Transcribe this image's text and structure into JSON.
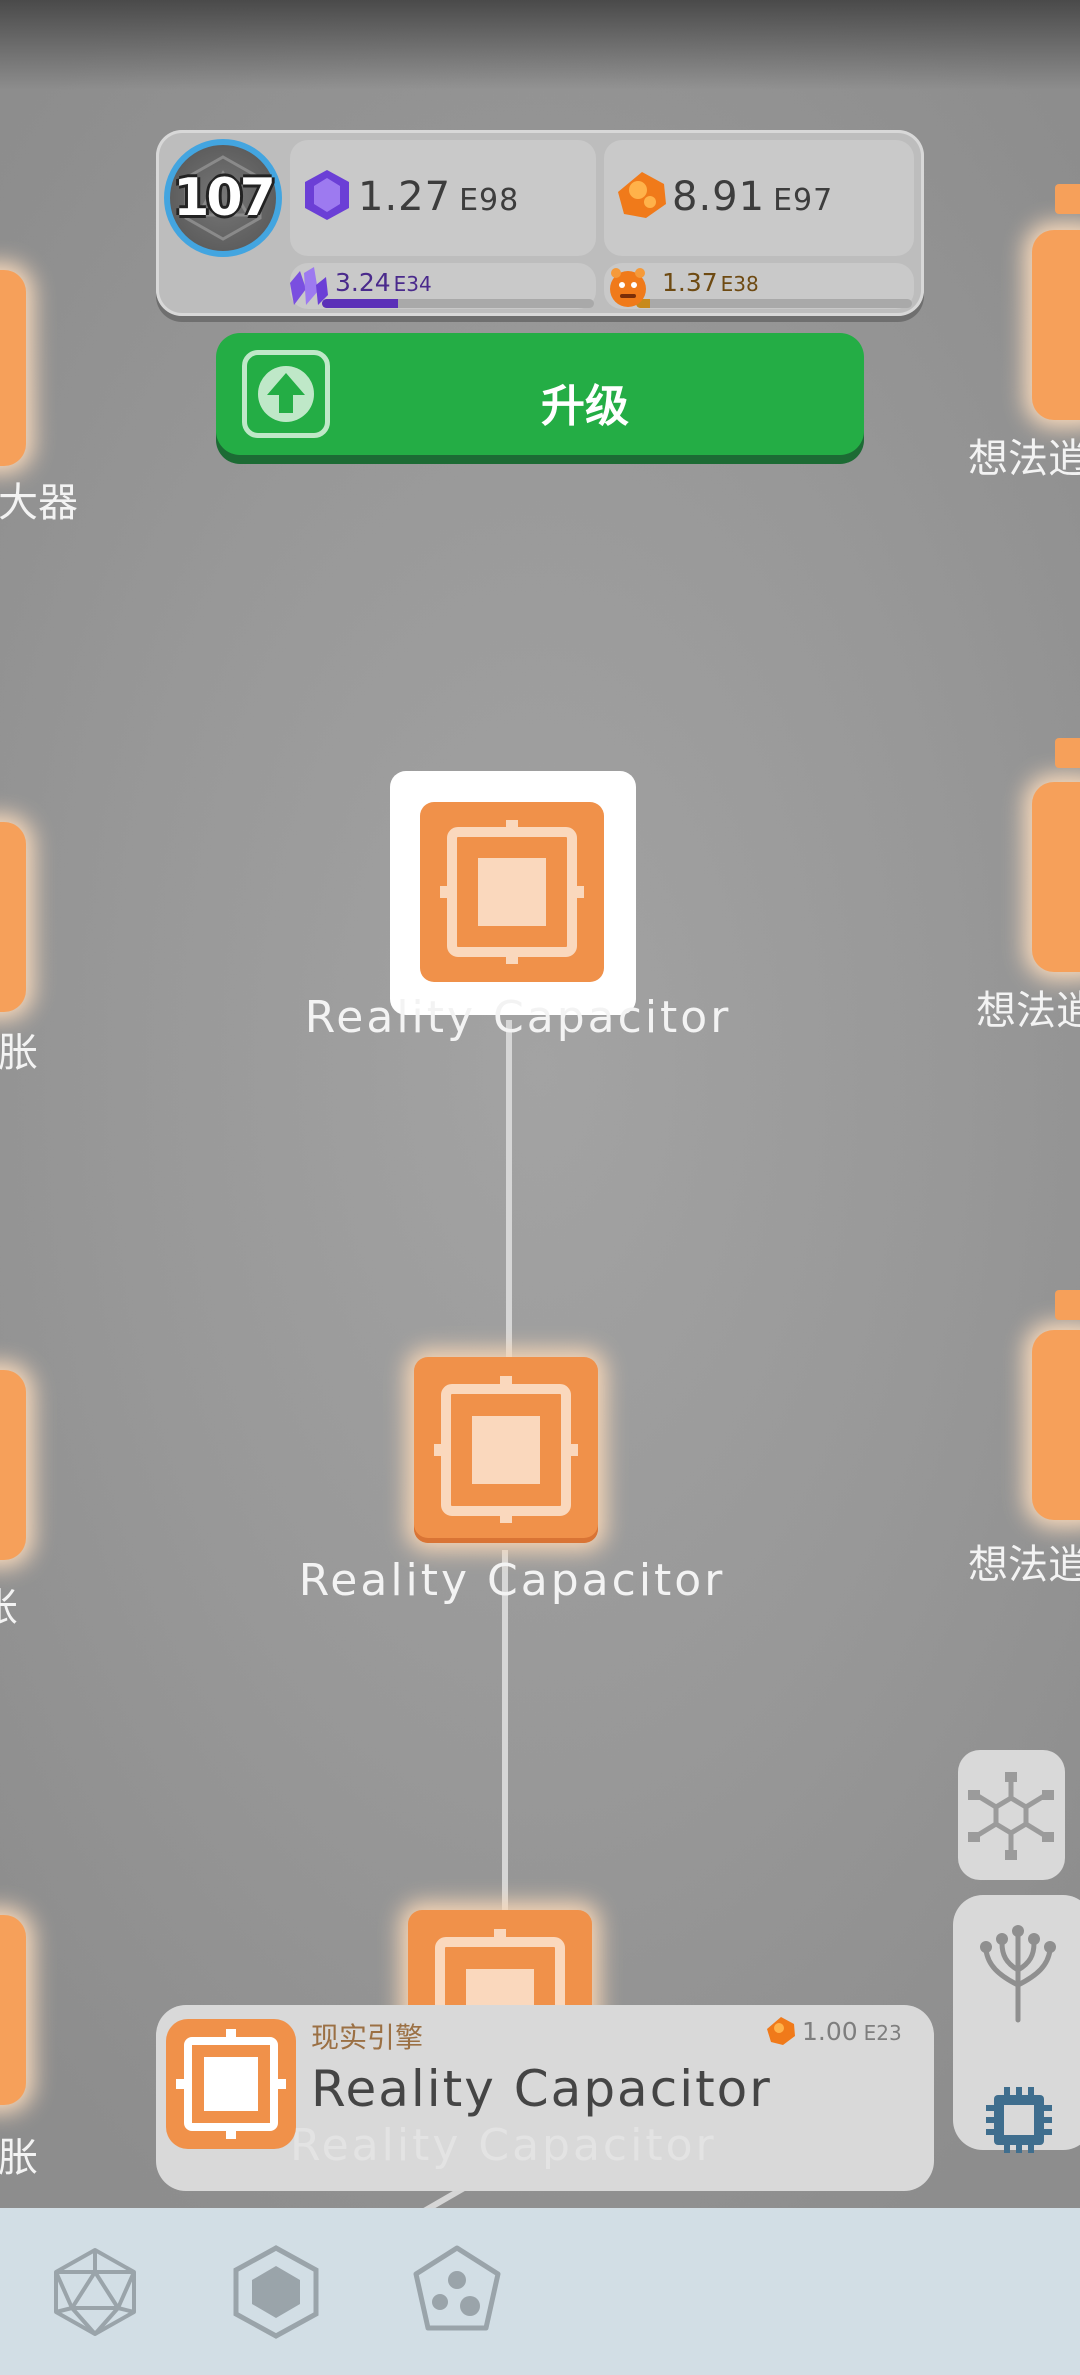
{
  "level": "107",
  "resources": {
    "crystal": {
      "mantissa": "1.27",
      "exp": "E98",
      "icon": "purple-crystal-icon",
      "color": "#6b3fd6"
    },
    "ore": {
      "mantissa": "8.91",
      "exp": "E97",
      "icon": "orange-ore-icon",
      "color": "#f07a1a"
    },
    "crystal_rate": {
      "mantissa": "3.24",
      "exp": "E34",
      "fill": 0.28,
      "color": "#5b2fb8"
    },
    "ore_rate": {
      "mantissa": "1.37",
      "exp": "E38",
      "fill": 0.05,
      "color": "#c78a1c"
    }
  },
  "upgrade_label": "升级",
  "nodes": [
    {
      "label": "Reality Capacitor",
      "selected": true
    },
    {
      "label": "Reality Capacitor",
      "selected": false
    },
    {
      "label": "Reality Capacitor",
      "selected": false
    }
  ],
  "left_labels": [
    "大器",
    "胀",
    "胀",
    "胀"
  ],
  "right_labels": [
    "想法逍",
    "想法逍",
    "想法逍"
  ],
  "info_card": {
    "subtitle": "现实引擎",
    "title": "Reality Capacitor",
    "cost_mantissa": "1.00",
    "cost_exp": "E23"
  },
  "colors": {
    "accent_green": "#24ad45",
    "node_orange": "#f0914a",
    "nav_bg": "#d2dee5"
  },
  "bottom_nav": [
    "icosahedron-icon",
    "hexagon-icon",
    "dice-blob-icon"
  ]
}
